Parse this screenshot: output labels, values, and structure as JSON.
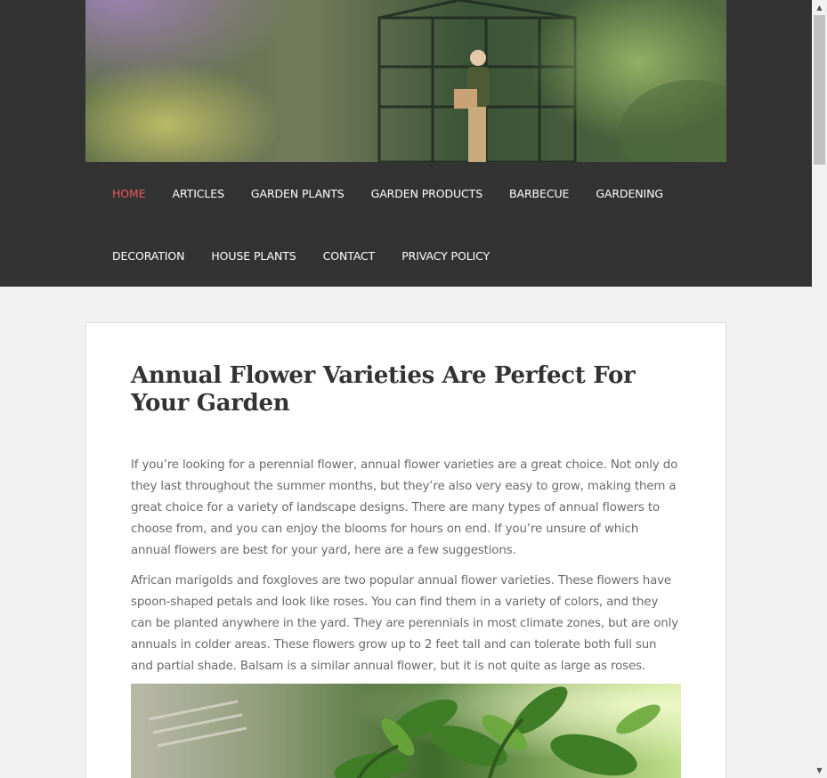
{
  "nav": {
    "items": [
      {
        "label": "HOME",
        "active": true
      },
      {
        "label": "ARTICLES",
        "active": false
      },
      {
        "label": "GARDEN PLANTS",
        "active": false
      },
      {
        "label": "GARDEN PRODUCTS",
        "active": false
      },
      {
        "label": "BARBECUE",
        "active": false
      },
      {
        "label": "GARDENING",
        "active": false
      },
      {
        "label": "DECORATION",
        "active": false
      },
      {
        "label": "HOUSE PLANTS",
        "active": false
      },
      {
        "label": "CONTACT",
        "active": false
      },
      {
        "label": "PRIVACY POLICY",
        "active": false
      }
    ]
  },
  "post": {
    "title": "Annual Flower Varieties Are Perfect For Your Garden",
    "paragraphs": [
      "If you’re looking for a perennial flower, annual flower varieties are a great choice. Not only do they last throughout the summer months, but they’re also very easy to grow, making them a great choice for a variety of landscape designs. There are many types of annual flowers to choose from, and you can enjoy the blooms for hours on end. If you’re unsure of which annual flowers are best for your yard, here are a few suggestions.",
      "African marigolds and foxgloves are two popular annual flower varieties. These flowers have spoon-shaped petals and look like roses. You can find them in a variety of colors, and they can be planted anywhere in the yard. They are perennials in most climate zones, but are only annuals in colder areas. These flowers grow up to 2 feet tall and can tolerate both full sun and partial shade. Balsam is a similar annual flower, but it is not quite as large as roses."
    ]
  },
  "scrollbar": {
    "up_glyph": "▲",
    "down_glyph": "▼"
  },
  "colors": {
    "header_bg": "#333333",
    "nav_active": "#e8595e",
    "page_bg": "#f1f1f1",
    "title": "#333333",
    "body_text": "#6a6a6a"
  }
}
